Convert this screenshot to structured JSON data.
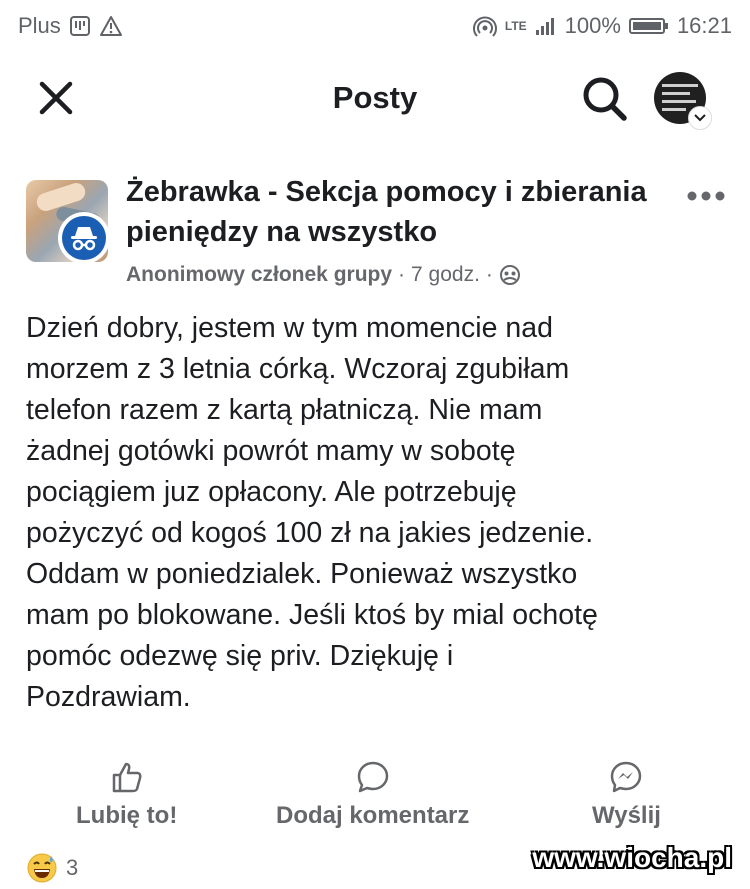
{
  "status_bar": {
    "carrier": "Plus",
    "network": "LTE",
    "battery": "100%",
    "time": "16:21"
  },
  "app_bar": {
    "title": "Posty",
    "icons": {
      "close": "close-icon",
      "search": "search-icon",
      "profile": "profile-avatar"
    }
  },
  "post": {
    "group_name": "Żebrawka - Sekcja pomocy i zbierania pieniędzy na wszystko",
    "author": "Anonimowy członek grupy",
    "separator": "·",
    "time_ago": "7 godz.",
    "body": "Dzień dobry, jestem w tym momencie nad\nmorzem z 3 letnia córką. Wczoraj zgubiłam\ntelefon razem z kartą płatniczą. Nie mam\nżadnej gotówki powrót mamy w sobotę\npociągiem juz opłacony. Ale potrzebuję\npożyczyć od kogoś 100 zł na jakies jedzenie.\nOddam w  poniedzialek. Ponieważ wszystko\nmam po blokowane. Jeśli ktoś by mial ochotę\npomóc odezwę się  priv. Dziękuję i\nPozdrawiam."
  },
  "actions": {
    "like_label": "Lubię to!",
    "comment_label": "Dodaj komentarz",
    "send_label": "Wyślij"
  },
  "reactions": {
    "emoji": "grinning-sweat-emoji",
    "count": "3"
  },
  "watermark": "www.wiocha.pl",
  "colors": {
    "text": "#1c1e21",
    "secondary": "#65676b",
    "badge_blue": "#1b5fb5",
    "status_gray": "#5f6368"
  }
}
